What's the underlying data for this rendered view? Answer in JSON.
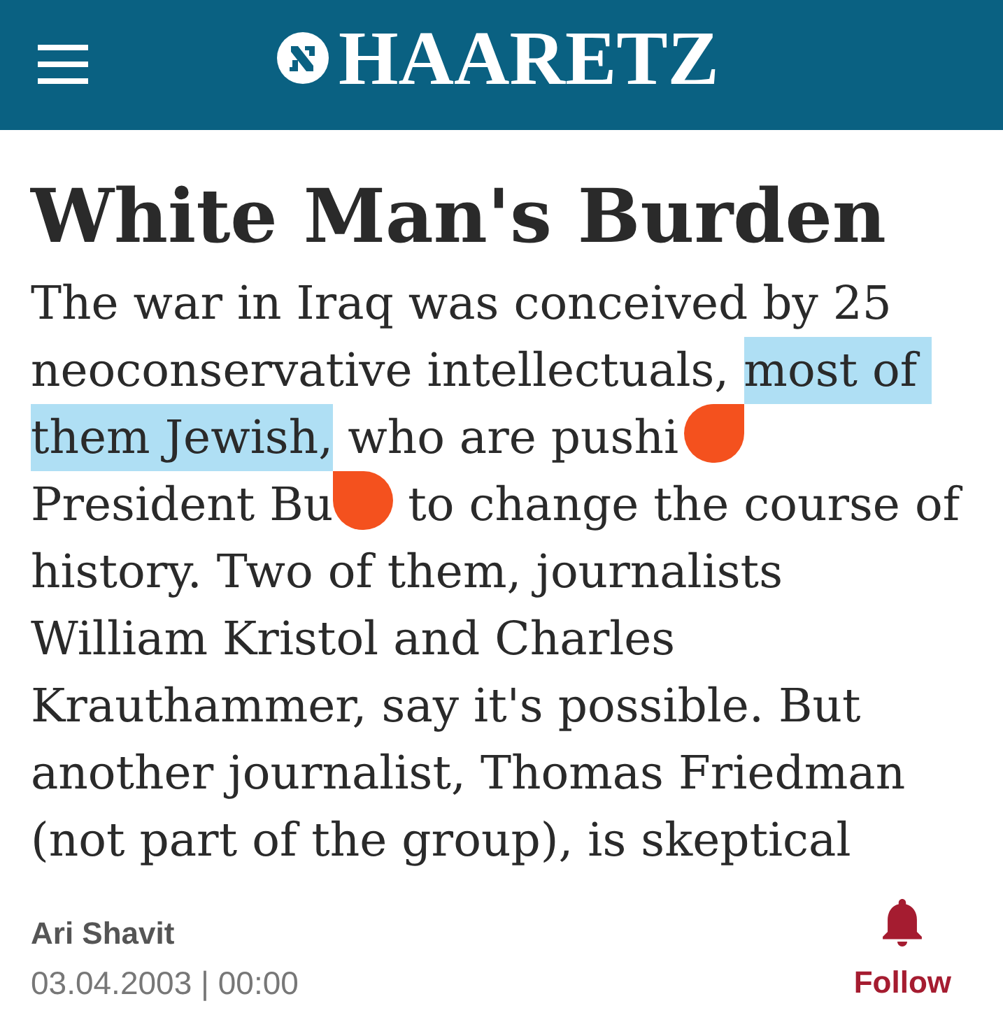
{
  "header": {
    "logo": "HAARETZ"
  },
  "article": {
    "title": "White Man's Burden",
    "summary": [
      {
        "kind": "text",
        "text": "The war in Iraq was conceived by 25 neoconservative intellectuals, ",
        "selected": false
      },
      {
        "kind": "text",
        "text": "most of ",
        "selected": true
      },
      {
        "kind": "text",
        "text": "them Jewish,",
        "selected": true
      },
      {
        "kind": "text",
        "text": " who are pushi",
        "selected": false
      },
      {
        "kind": "starthandle"
      },
      {
        "kind": "text",
        "text": " President Bu",
        "selected": false
      },
      {
        "kind": "endhandle"
      },
      {
        "kind": "text",
        "text": " to change the course of history. Two of them, journalists William Kristol and Charles Krauthammer, say it's possible. But another journalist, Thomas Friedman (not part of the group), is skeptical",
        "selected": false
      }
    ],
    "author": "Ari Shavit",
    "date": "03.04.2003 | 00:00",
    "follow": {
      "label": "Follow"
    }
  }
}
